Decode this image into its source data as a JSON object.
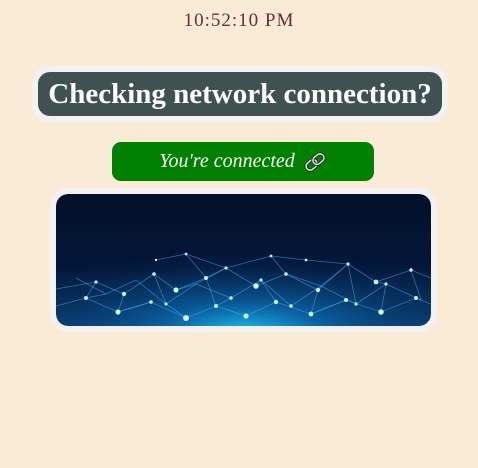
{
  "clock": {
    "time": "10:52:10 PM"
  },
  "header": {
    "title": "Checking network connection?"
  },
  "status": {
    "text": "You're connected",
    "icon": "link-icon",
    "color": "#008000"
  },
  "hero_image": {
    "icon": "network-graphic"
  },
  "colors": {
    "background": "#faebd7",
    "title_bg": "#3f5150",
    "status_bg": "#008000",
    "clock_text": "#6b2a3a"
  }
}
